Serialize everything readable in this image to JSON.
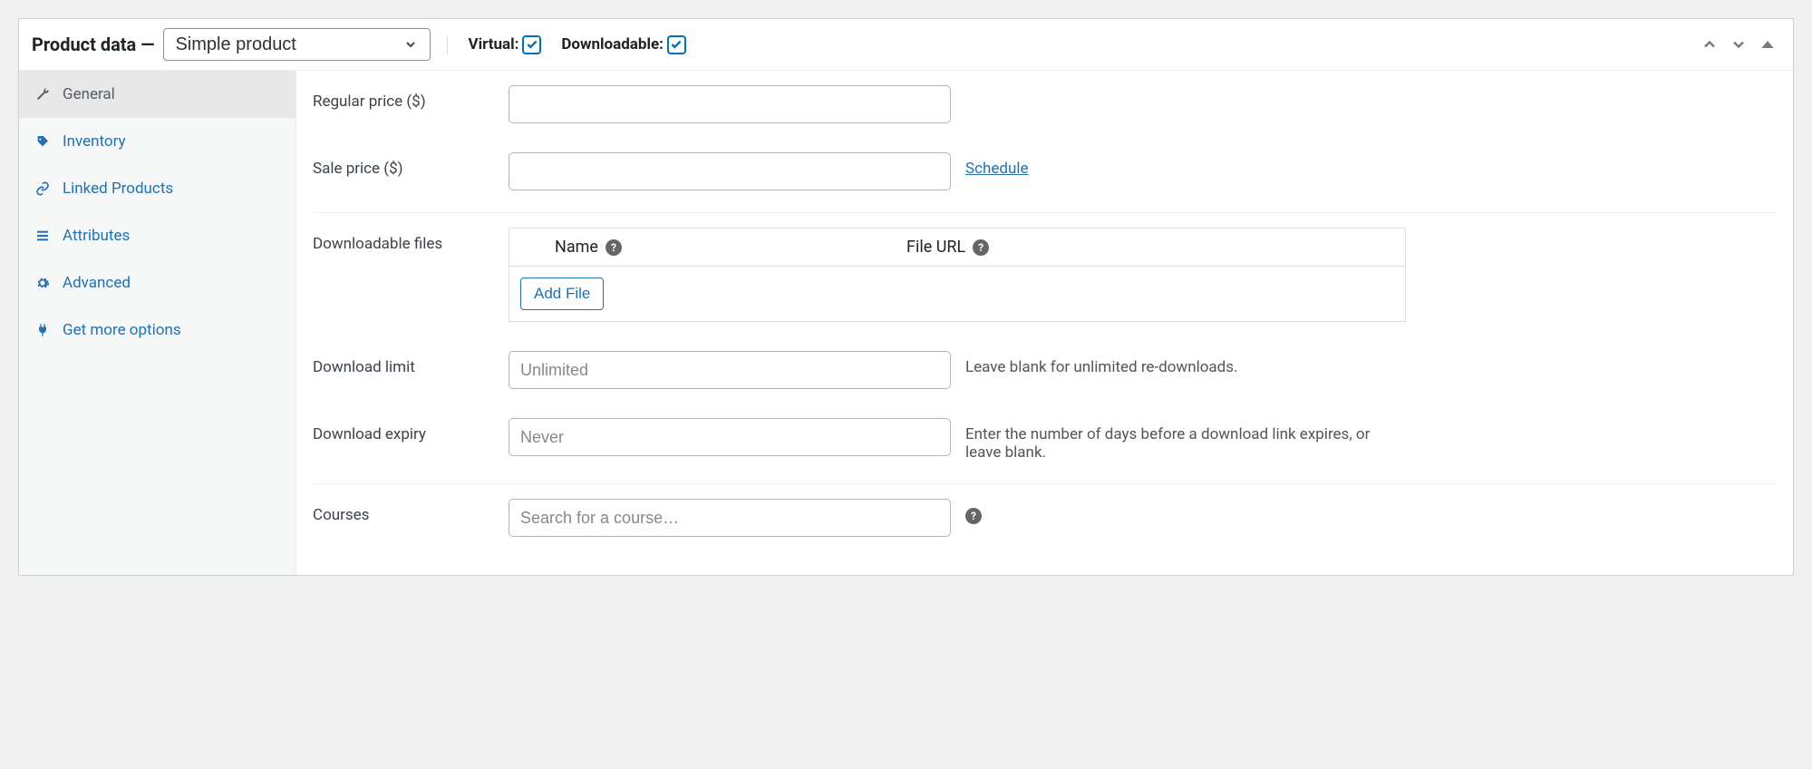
{
  "header": {
    "title": "Product data —",
    "product_type": "Simple product",
    "virtual_label": "Virtual:",
    "virtual_checked": true,
    "downloadable_label": "Downloadable:",
    "downloadable_checked": true
  },
  "tabs": [
    {
      "id": "general",
      "label": "General",
      "icon": "wrench",
      "active": true
    },
    {
      "id": "inventory",
      "label": "Inventory",
      "icon": "tag",
      "active": false
    },
    {
      "id": "linked",
      "label": "Linked Products",
      "icon": "link",
      "active": false
    },
    {
      "id": "attributes",
      "label": "Attributes",
      "icon": "list",
      "active": false
    },
    {
      "id": "advanced",
      "label": "Advanced",
      "icon": "gear",
      "active": false
    },
    {
      "id": "more",
      "label": "Get more options",
      "icon": "plug",
      "active": false
    }
  ],
  "fields": {
    "regular_price": {
      "label": "Regular price ($)",
      "value": ""
    },
    "sale_price": {
      "label": "Sale price ($)",
      "value": "",
      "schedule_label": "Schedule"
    },
    "downloadable_files": {
      "label": "Downloadable files",
      "col_name": "Name",
      "col_url": "File URL",
      "add_file_label": "Add File"
    },
    "download_limit": {
      "label": "Download limit",
      "placeholder": "Unlimited",
      "value": "",
      "help": "Leave blank for unlimited re-downloads."
    },
    "download_expiry": {
      "label": "Download expiry",
      "placeholder": "Never",
      "value": "",
      "help": "Enter the number of days before a download link expires, or leave blank."
    },
    "courses": {
      "label": "Courses",
      "placeholder": "Search for a course…",
      "value": ""
    }
  }
}
